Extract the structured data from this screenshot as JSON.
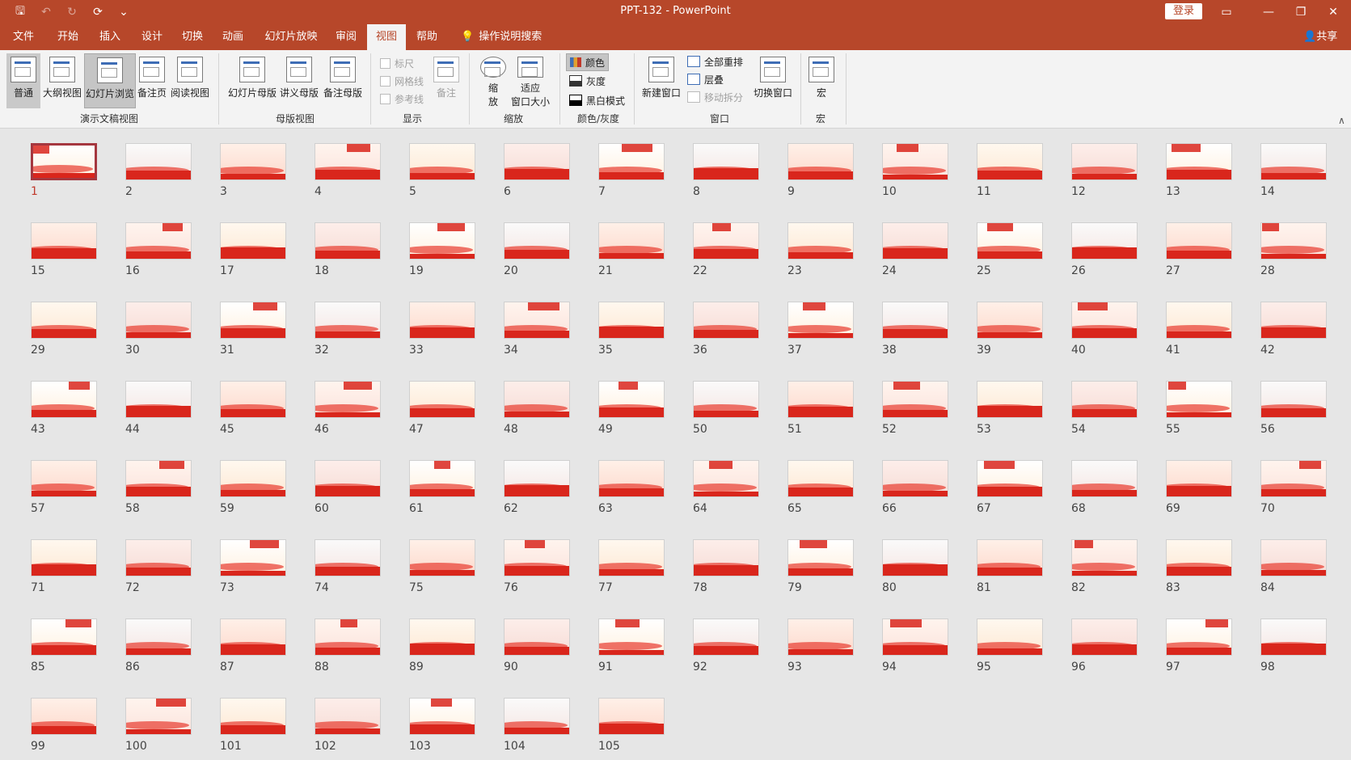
{
  "window": {
    "title": "PPT-132  -  PowerPoint",
    "login": "登录"
  },
  "tabs": [
    {
      "label": "文件"
    },
    {
      "label": "开始"
    },
    {
      "label": "插入"
    },
    {
      "label": "设计"
    },
    {
      "label": "切换"
    },
    {
      "label": "动画"
    },
    {
      "label": "幻灯片放映"
    },
    {
      "label": "审阅"
    },
    {
      "label": "视图",
      "active": true
    },
    {
      "label": "帮助"
    }
  ],
  "tell_me": "操作说明搜索",
  "share": "共享",
  "ribbon": {
    "presentation_views": {
      "label": "演示文稿视图",
      "buttons": [
        "普通",
        "大纲视图",
        "幻灯片浏览",
        "备注页",
        "阅读视图"
      ],
      "selected": "幻灯片浏览"
    },
    "master_views": {
      "label": "母版视图",
      "buttons": [
        "幻灯片母版",
        "讲义母版",
        "备注母版"
      ]
    },
    "show": {
      "label": "显示",
      "checks": [
        "标尺",
        "网格线",
        "参考线"
      ],
      "notes": "备注"
    },
    "zoom": {
      "label": "缩放",
      "zoom_btn": "缩\n放",
      "fit_btn": "适应\n窗口大小"
    },
    "color": {
      "label": "颜色/灰度",
      "items": [
        "颜色",
        "灰度",
        "黑白模式"
      ]
    },
    "window": {
      "label": "窗口",
      "new_window": "新建窗口",
      "items": [
        "全部重排",
        "层叠",
        "移动拆分"
      ],
      "switch": "切换窗口"
    },
    "macros": {
      "label": "宏",
      "button": "宏"
    }
  },
  "slides": {
    "count": 105,
    "selected": 1,
    "numbers": [
      "1",
      "2",
      "3",
      "4",
      "5",
      "6",
      "7",
      "8",
      "9",
      "10",
      "11",
      "12",
      "13",
      "14",
      "15",
      "16",
      "17",
      "18",
      "19",
      "20",
      "21",
      "22",
      "23",
      "24",
      "25",
      "26",
      "27",
      "28",
      "29",
      "30",
      "31",
      "32",
      "33",
      "34",
      "35",
      "36",
      "37",
      "38",
      "39",
      "40",
      "41",
      "42",
      "43",
      "44",
      "45",
      "46",
      "47",
      "48",
      "49",
      "50",
      "51",
      "52",
      "53",
      "54",
      "55",
      "56",
      "57",
      "58",
      "59",
      "60",
      "61",
      "62",
      "63",
      "64",
      "65",
      "66",
      "67",
      "68",
      "69",
      "70",
      "71",
      "72",
      "73",
      "74",
      "75",
      "76",
      "77",
      "78",
      "79",
      "80",
      "81",
      "82",
      "83",
      "84",
      "85",
      "86",
      "87",
      "88",
      "89",
      "90",
      "91",
      "92",
      "93",
      "94",
      "95",
      "96",
      "97",
      "98",
      "99",
      "100",
      "101",
      "102",
      "103",
      "104",
      "105"
    ]
  },
  "colors": {
    "accent": "#b7472a",
    "slide_red": "#d9261c"
  }
}
